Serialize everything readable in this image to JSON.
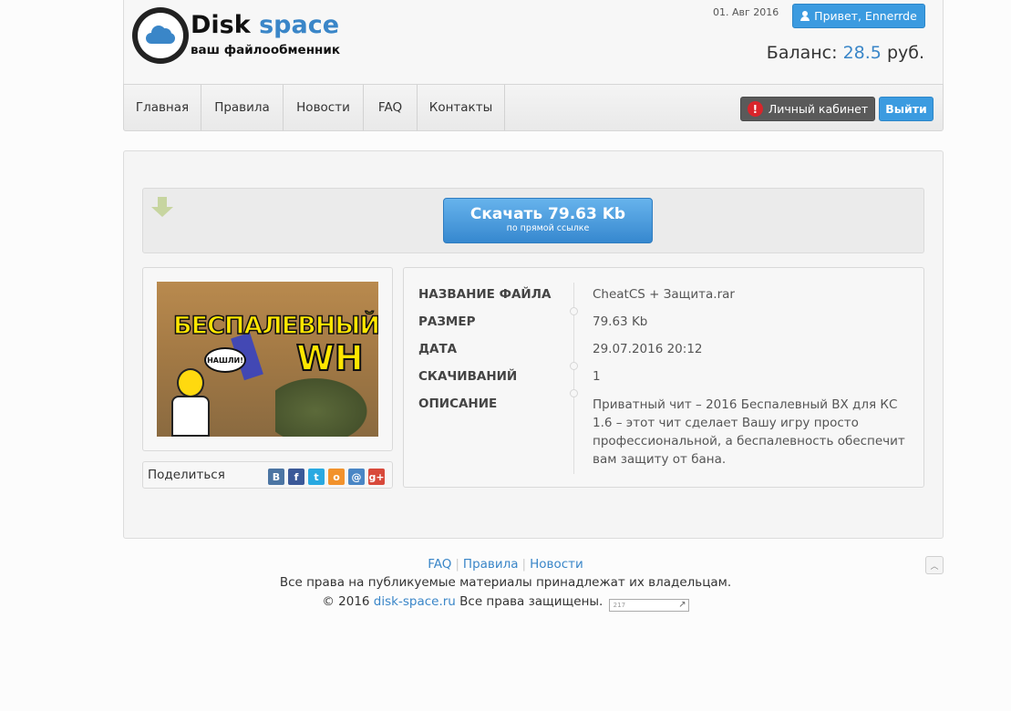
{
  "header": {
    "logo_title_a": "Disk",
    "logo_title_b": "space",
    "logo_subtitle": "ваш файлообменник",
    "date": "01. Авг 2016",
    "greeting": "Привет, Ennerrde",
    "balance_label": "Баланс:",
    "balance_value": "28.5",
    "balance_currency": "руб."
  },
  "nav": {
    "items": [
      {
        "label": "Главная"
      },
      {
        "label": "Правила"
      },
      {
        "label": "Новости"
      },
      {
        "label": "FAQ"
      },
      {
        "label": "Контакты"
      }
    ],
    "cabinet_label": "Личный кабинет",
    "cabinet_alert": "!",
    "login_label": "Выйти"
  },
  "download": {
    "button_title": "Скачать 79.63 Kb",
    "button_sub": "по прямой ссылке"
  },
  "preview": {
    "caption_top": "БЕСПАЛЕВНЫЙ",
    "caption_wh": "WH",
    "bubble": "НАШЛИ!"
  },
  "share": {
    "label": "Поделиться",
    "icons": [
      {
        "name": "vk",
        "glyph": "В",
        "color": "#4c75a3"
      },
      {
        "name": "facebook",
        "glyph": "f",
        "color": "#3b5998"
      },
      {
        "name": "twitter",
        "glyph": "t",
        "color": "#29a9e1"
      },
      {
        "name": "odnoklassniki",
        "glyph": "о",
        "color": "#f2922c"
      },
      {
        "name": "mail",
        "glyph": "@",
        "color": "#4a86c5"
      },
      {
        "name": "google-plus",
        "glyph": "g+",
        "color": "#d8493b"
      }
    ]
  },
  "file_info": {
    "rows": [
      {
        "key": "НАЗВАНИЕ ФАЙЛА",
        "value": "CheatCS + Защита.rar"
      },
      {
        "key": "РАЗМЕР",
        "value": "79.63 Kb"
      },
      {
        "key": "ДАТА",
        "value": "29.07.2016 20:12"
      },
      {
        "key": "СКАЧИВАНИЙ",
        "value": "1"
      },
      {
        "key": "ОПИСАНИЕ",
        "value": "Приватный чит – 2016 Беспалевный ВХ для КС 1.6 – этот чит сделает Вашу игру просто профессиональной, а беспалевность обеспечит вам защиту от бана."
      }
    ]
  },
  "footer": {
    "links": [
      {
        "label": "FAQ"
      },
      {
        "label": "Правила"
      },
      {
        "label": "Новости"
      }
    ],
    "rights": "Все права на публикуемые материалы принадлежат их владельцам.",
    "copyright_prefix": "© 2016",
    "site_link": "disk-space.ru",
    "copyright_suffix": "Все права защищены.",
    "counter_text": "217"
  }
}
